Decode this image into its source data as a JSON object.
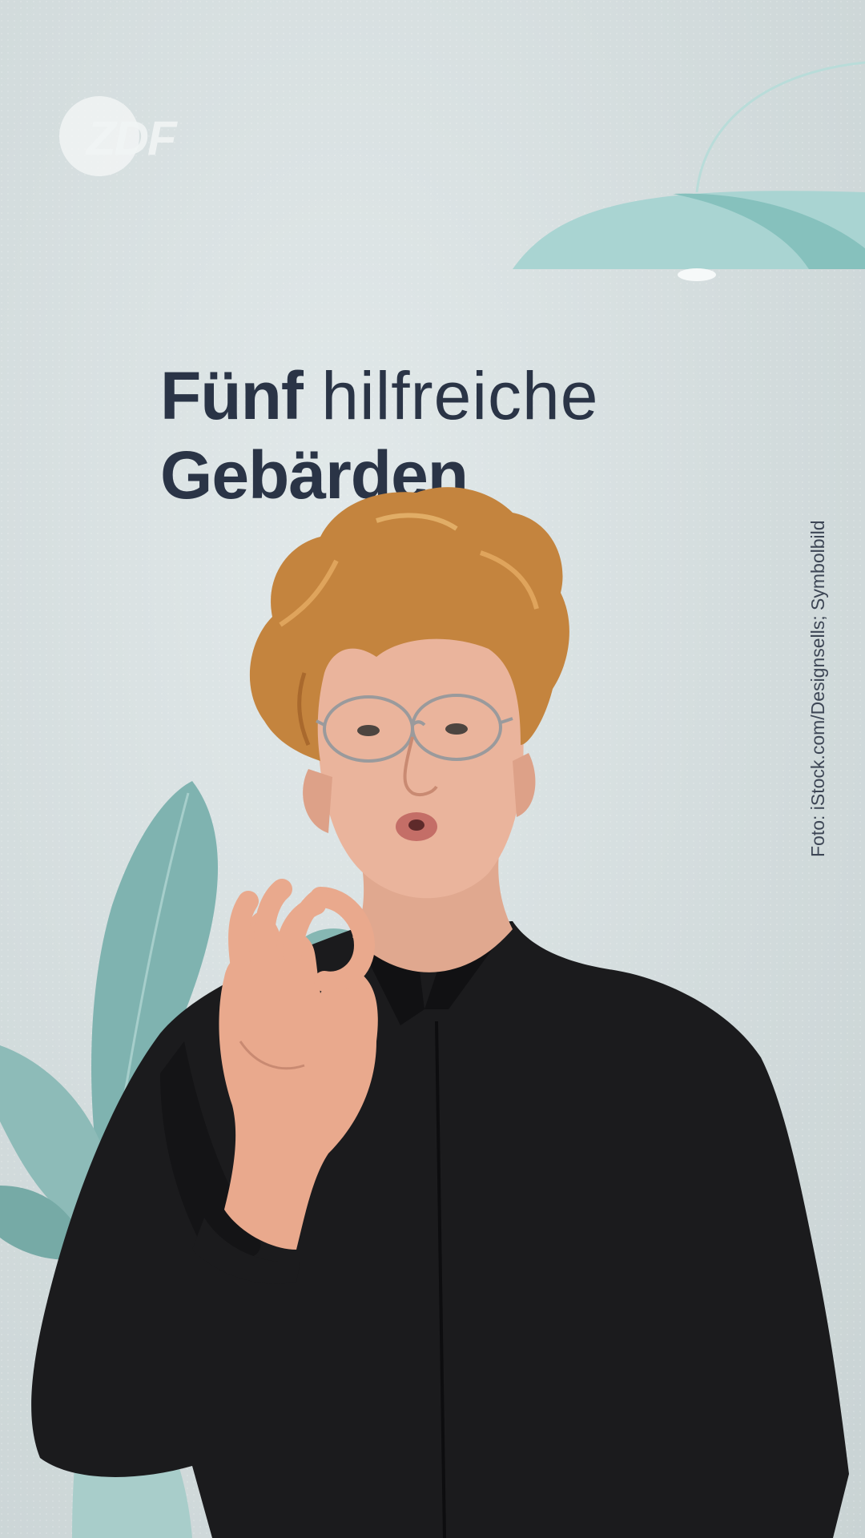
{
  "logo": {
    "text": "ZDF"
  },
  "headline": {
    "word1": "Fünf",
    "word2": "hilfreiche",
    "line2": "Gebärden"
  },
  "photo_credit": "Foto: iStock.com/Designsells; Symbolbild",
  "colors": {
    "background": "#d6dfe0",
    "headline": "#2a3446",
    "accent_teal": "#7fb3b0",
    "accent_light_teal": "#a9d2d0",
    "shirt": "#1b1b1d",
    "hair": "#c4843e"
  },
  "illustrations": {
    "person": "signing person with curly blond hair, glasses and black shirt",
    "plant": "teal plant leaves",
    "lamp": "teal pendant lamp"
  }
}
